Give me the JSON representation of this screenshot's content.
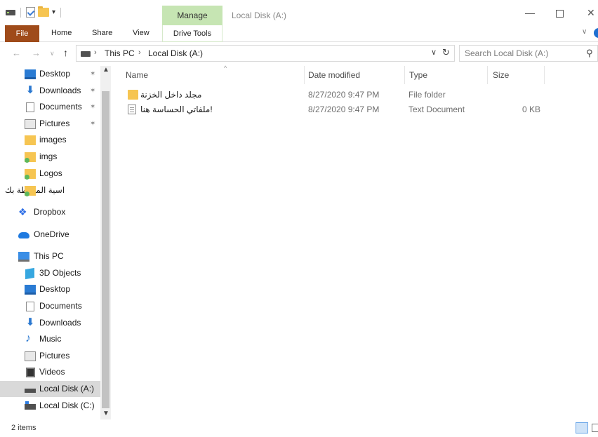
{
  "window": {
    "title": "Local Disk (A:)",
    "manage_tab": "Manage"
  },
  "ribbon": {
    "tabs": [
      "File",
      "Home",
      "Share",
      "View",
      "Drive Tools"
    ]
  },
  "address": {
    "crumbs": [
      "This PC",
      "Local Disk (A:)"
    ],
    "search_placeholder": "Search Local Disk (A:)"
  },
  "sidebar": {
    "quick_access": [
      {
        "label": "Desktop",
        "icon": "desktop-icon",
        "pinned": true
      },
      {
        "label": "Downloads",
        "icon": "download-icon",
        "pinned": true
      },
      {
        "label": "Documents",
        "icon": "document-icon",
        "pinned": true
      },
      {
        "label": "Pictures",
        "icon": "pictures-icon",
        "pinned": true
      },
      {
        "label": "images",
        "icon": "folder-icon",
        "pinned": false
      },
      {
        "label": "imgs",
        "icon": "folder-icon",
        "pinned": false
      },
      {
        "label": "Logos",
        "icon": "folder-icon",
        "pinned": false
      },
      {
        "label": "اسية المحيطة بك",
        "icon": "folder-icon",
        "pinned": false
      }
    ],
    "dropbox": "Dropbox",
    "onedrive": "OneDrive",
    "this_pc": "This PC",
    "pc_items": [
      {
        "label": "3D Objects",
        "icon": "3d-objects-icon"
      },
      {
        "label": "Desktop",
        "icon": "desktop-icon"
      },
      {
        "label": "Documents",
        "icon": "document-icon"
      },
      {
        "label": "Downloads",
        "icon": "download-icon"
      },
      {
        "label": "Music",
        "icon": "music-icon"
      },
      {
        "label": "Pictures",
        "icon": "pictures-icon"
      },
      {
        "label": "Videos",
        "icon": "videos-icon"
      },
      {
        "label": "Local Disk (A:)",
        "icon": "drive-icon",
        "selected": true
      },
      {
        "label": "Local Disk (C:)",
        "icon": "drive-icon"
      }
    ]
  },
  "columns": {
    "name": "Name",
    "date": "Date modified",
    "type": "Type",
    "size": "Size"
  },
  "files": [
    {
      "name": "مجلد داخل الخزنة",
      "date": "8/27/2020 9:47 PM",
      "type": "File folder",
      "size": "",
      "icon": "folder-icon"
    },
    {
      "name": "!ملفاتي الحساسة هنا",
      "date": "8/27/2020 9:47 PM",
      "type": "Text Document",
      "size": "0 KB",
      "icon": "text-document-icon"
    }
  ],
  "status": {
    "items": "2 items"
  },
  "colors": {
    "file_tab": "#9f4b1a",
    "manage_tab": "#c6e5b3",
    "selected_nav": "#d9d9d9"
  }
}
